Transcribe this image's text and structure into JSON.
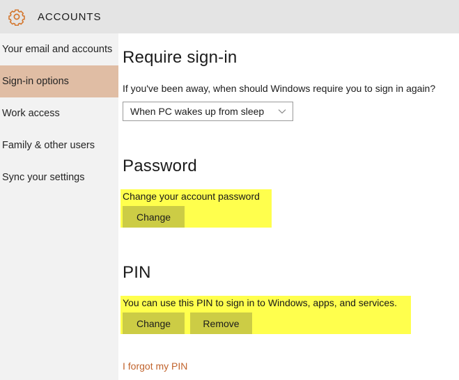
{
  "header": {
    "icon": "gear-icon",
    "title": "ACCOUNTS",
    "accent_color": "#d4752b",
    "background": "#e4e4e4"
  },
  "sidebar": {
    "background": "#f2f2f2",
    "selected_background": "#e0bda4",
    "items": [
      {
        "label": "Your email and accounts",
        "selected": false
      },
      {
        "label": "Sign-in options",
        "selected": true
      },
      {
        "label": "Work access",
        "selected": false
      },
      {
        "label": "Family & other users",
        "selected": false
      },
      {
        "label": "Sync your settings",
        "selected": false
      }
    ]
  },
  "main": {
    "require_signin": {
      "heading": "Require sign-in",
      "description": "If you've been away, when should Windows require you to sign in again?",
      "dropdown_value": "When PC wakes up from sleep",
      "dropdown_icon": "chevron-down-icon"
    },
    "password": {
      "heading": "Password",
      "description": "Change your account password",
      "change_label": "Change",
      "highlight_color": "#ffff4d"
    },
    "pin": {
      "heading": "PIN",
      "description": "You can use this PIN to sign in to Windows, apps, and services.",
      "change_label": "Change",
      "remove_label": "Remove",
      "forgot_link": "I forgot my PIN",
      "highlight_color": "#ffff4d",
      "link_color": "#c1632c"
    }
  }
}
